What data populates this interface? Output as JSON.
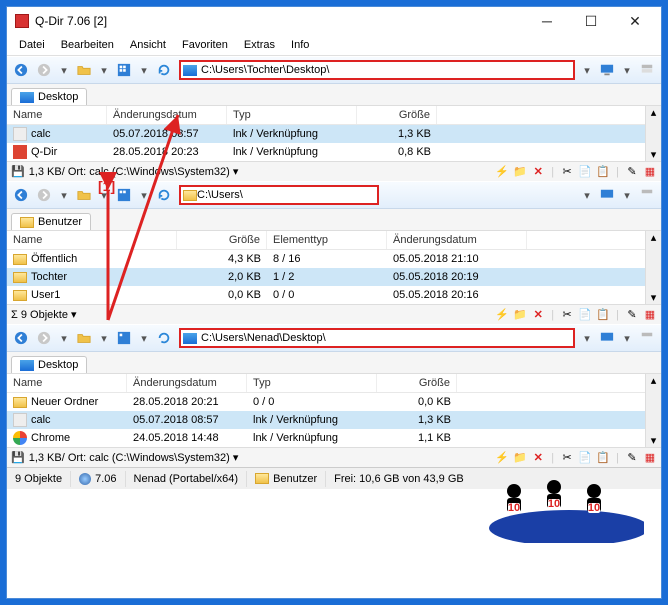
{
  "window": {
    "title": "Q-Dir 7.06 [2]"
  },
  "menu": {
    "items": [
      "Datei",
      "Bearbeiten",
      "Ansicht",
      "Favoriten",
      "Extras",
      "Info"
    ]
  },
  "pane1": {
    "path": "C:\\Users\\Tochter\\Desktop\\",
    "tab": "Desktop",
    "cols": [
      "Name",
      "Änderungsdatum",
      "Typ",
      "Größe"
    ],
    "rows": [
      {
        "name": "calc",
        "date": "05.07.2018 08:57",
        "type": "lnk / Verknüpfung",
        "size": "1,3 KB"
      },
      {
        "name": "Q-Dir",
        "date": "28.05.2018 20:23",
        "type": "lnk / Verknüpfung",
        "size": "0,8 KB"
      }
    ],
    "status": "1,3 KB/ Ort: calc (C:\\Windows\\System32) ▾"
  },
  "pane2": {
    "path": "C:\\Users\\",
    "tab": "Benutzer",
    "cols": [
      "Name",
      "Größe",
      "Elementtyp",
      "Änderungsdatum"
    ],
    "rows": [
      {
        "name": "Öffentlich",
        "size": "4,3 KB",
        "elem": "8 / 16",
        "date": "05.05.2018 21:10"
      },
      {
        "name": "Tochter",
        "size": "2,0 KB",
        "elem": "1 / 2",
        "date": "05.05.2018 20:19"
      },
      {
        "name": "User1",
        "size": "0,0 KB",
        "elem": "0 / 0",
        "date": "05.05.2018 20:16"
      }
    ],
    "status": "Σ  9 Objekte ▾"
  },
  "pane3": {
    "path": "C:\\Users\\Nenad\\Desktop\\",
    "tab": "Desktop",
    "cols": [
      "Name",
      "Änderungsdatum",
      "Typ",
      "Größe"
    ],
    "rows": [
      {
        "name": "Neuer Ordner",
        "date": "28.05.2018 20:21",
        "type": "0 / 0",
        "size": "0,0 KB"
      },
      {
        "name": "calc",
        "date": "05.07.2018 08:57",
        "type": "lnk / Verknüpfung",
        "size": "1,3 KB"
      },
      {
        "name": "Chrome",
        "date": "24.05.2018 14:48",
        "type": "lnk / Verknüpfung",
        "size": "1,1 KB"
      }
    ],
    "status": "1,3 KB/ Ort: calc (C:\\Windows\\System32) ▾"
  },
  "bottombar": {
    "objects": "9 Objekte",
    "version": "7.06",
    "user": "Nenad (Portabel/x64)",
    "folder": "Benutzer",
    "free": "Frei: 10,6 GB von 43,9 GB"
  },
  "annotation": {
    "label": "[1]"
  }
}
